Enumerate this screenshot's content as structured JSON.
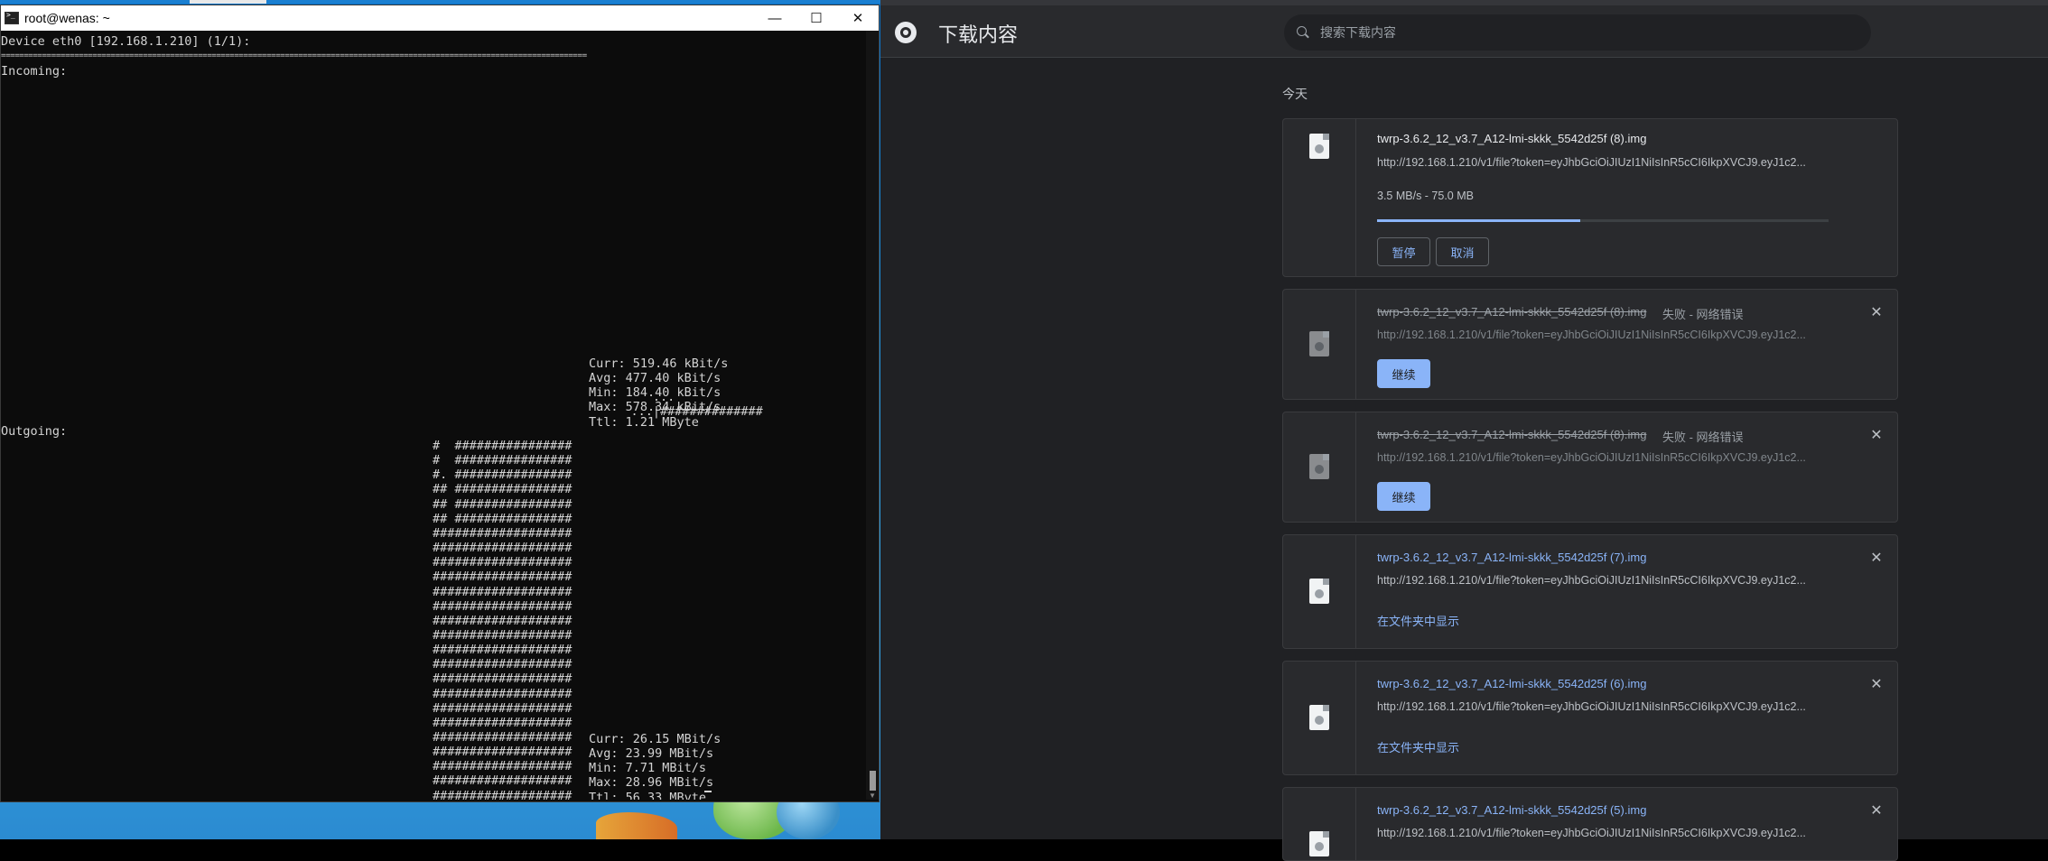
{
  "terminal": {
    "title": "root@wenas: ~",
    "device_line": "Device eth0 [192.168.1.210] (1/1):",
    "separator": "================================================================================================================================",
    "incoming_label": "Incoming:",
    "outgoing_label": "Outgoing:",
    "incoming_graph": [
      "                              ...",
      "                           ...|##############"
    ],
    "incoming_stats": [
      "Curr: 519.46 kBit/s",
      "Avg: 477.40 kBit/s",
      "Min: 184.40 kBit/s",
      "Max: 578.34 kBit/s",
      "Ttl: 1.21 MByte"
    ],
    "outgoing_graph": [
      "#  ################",
      "#  ################",
      "#. ################",
      "## ################",
      "## ################",
      "## ################",
      "###################",
      "###################",
      "###################",
      "###################",
      "###################",
      "###################",
      "###################",
      "###################",
      "###################",
      "###################",
      "###################",
      "###################",
      "###################",
      "###################",
      "###################",
      "###################",
      "###################",
      "###################",
      "###################",
      "###################"
    ],
    "outgoing_stats": [
      "Curr: 26.15 MBit/s",
      "Avg: 23.99 MBit/s",
      "Min: 7.71 MBit/s",
      "Max: 28.96 MBit/s",
      "Ttl: 56.33 MByte"
    ],
    "minimize_icon": "minimize-icon",
    "maximize_icon": "maximize-icon",
    "close_icon": "close-icon"
  },
  "browser": {
    "page_title": "下载内容",
    "search_placeholder": "搜索下载内容",
    "date_header": "今天",
    "accent_color": "#8ab4f8",
    "downloads": [
      {
        "filename": "twrp-3.6.2_12_v3.7_A12-lmi-skkk_5542d25f (8).img",
        "url": "http://192.168.1.210/v1/file?token=eyJhbGciOiJIUzI1NiIsInR5cCI6IkpXVCJ9.eyJ1c2...",
        "progress_text": "3.5 MB/s - 75.0 MB",
        "progress_fraction": 0.45,
        "pause_label": "暂停",
        "cancel_label": "取消"
      },
      {
        "filename": "twrp-3.6.2_12_v3.7_A12-lmi-skkk_5542d25f (8).img",
        "status": "失败 - 网络错误",
        "url": "http://192.168.1.210/v1/file?token=eyJhbGciOiJIUzI1NiIsInR5cCI6IkpXVCJ9.eyJ1c2...",
        "resume_label": "继续"
      },
      {
        "filename": "twrp-3.6.2_12_v3.7_A12-lmi-skkk_5542d25f (8).img",
        "status": "失败 - 网络错误",
        "url": "http://192.168.1.210/v1/file?token=eyJhbGciOiJIUzI1NiIsInR5cCI6IkpXVCJ9.eyJ1c2...",
        "resume_label": "继续"
      },
      {
        "filename": "twrp-3.6.2_12_v3.7_A12-lmi-skkk_5542d25f (7).img",
        "url": "http://192.168.1.210/v1/file?token=eyJhbGciOiJIUzI1NiIsInR5cCI6IkpXVCJ9.eyJ1c2...",
        "show_in_folder": "在文件夹中显示"
      },
      {
        "filename": "twrp-3.6.2_12_v3.7_A12-lmi-skkk_5542d25f (6).img",
        "url": "http://192.168.1.210/v1/file?token=eyJhbGciOiJIUzI1NiIsInR5cCI6IkpXVCJ9.eyJ1c2...",
        "show_in_folder": "在文件夹中显示"
      },
      {
        "filename": "twrp-3.6.2_12_v3.7_A12-lmi-skkk_5542d25f (5).img",
        "url": "http://192.168.1.210/v1/file?token=eyJhbGciOiJIUzI1NiIsInR5cCI6IkpXVCJ9.eyJ1c2..."
      }
    ]
  }
}
